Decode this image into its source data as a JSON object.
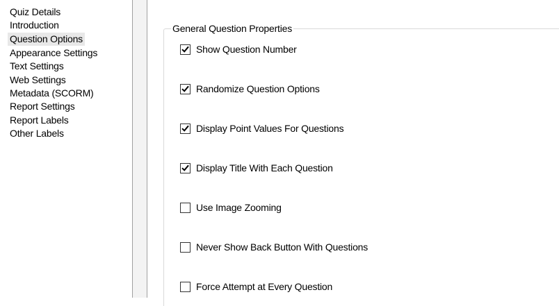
{
  "sidebar": {
    "items": [
      {
        "label": "Quiz Details"
      },
      {
        "label": "Introduction"
      },
      {
        "label": "Question Options",
        "selected": true
      },
      {
        "label": "Appearance Settings"
      },
      {
        "label": "Text Settings"
      },
      {
        "label": "Web Settings"
      },
      {
        "label": "Metadata (SCORM)"
      },
      {
        "label": "Report Settings"
      },
      {
        "label": "Report Labels"
      },
      {
        "label": "Other Labels"
      }
    ]
  },
  "main": {
    "group_title": "General Question Properties",
    "options": [
      {
        "label": "Show Question Number",
        "checked": true
      },
      {
        "label": "Randomize Question Options",
        "checked": true
      },
      {
        "label": "Display Point Values For Questions",
        "checked": true
      },
      {
        "label": "Display Title With Each Question",
        "checked": true
      },
      {
        "label": "Use Image Zooming",
        "checked": false
      },
      {
        "label": "Never Show Back Button With Questions",
        "checked": false
      },
      {
        "label": "Force Attempt at Every Question",
        "checked": false
      }
    ]
  },
  "colors": {
    "selected_background": "#e8e8e8",
    "groupbox_border": "#d9d9d9",
    "splitter": "#f3f3f3"
  },
  "icons": {
    "check": "check-icon"
  }
}
